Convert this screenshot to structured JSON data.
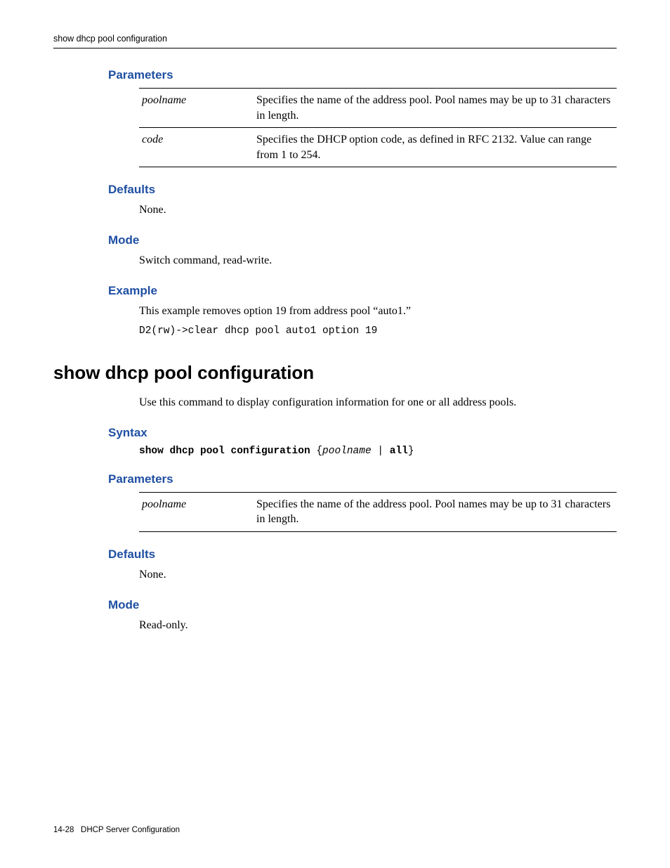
{
  "running_head": "show dhcp pool configuration",
  "sec1": {
    "parameters_heading": "Parameters",
    "table": [
      {
        "name": "poolname",
        "desc": "Specifies the name of the address pool. Pool names may be up to 31 characters in length."
      },
      {
        "name": "code",
        "desc": "Specifies the DHCP option code, as defined in RFC 2132. Value can range from 1 to 254."
      }
    ],
    "defaults_heading": "Defaults",
    "defaults_body": "None.",
    "mode_heading": "Mode",
    "mode_body": "Switch command, read-write.",
    "example_heading": "Example",
    "example_body": "This example removes option 19 from address pool “auto1.”",
    "example_code": "D2(rw)->clear dhcp pool auto1 option 19"
  },
  "cmd_title": "show dhcp pool configuration",
  "cmd_intro": "Use this command to display configuration information for one or all address pools.",
  "sec2": {
    "syntax_heading": "Syntax",
    "syntax_bold1": "show dhcp pool configuration",
    "syntax_brace_open": " {",
    "syntax_italic": "poolname",
    "syntax_sep": " | ",
    "syntax_bold2": "all",
    "syntax_brace_close": "}",
    "parameters_heading": "Parameters",
    "table": [
      {
        "name": "poolname",
        "desc": "Specifies the name of the address pool. Pool names may be up to 31 characters in length."
      }
    ],
    "defaults_heading": "Defaults",
    "defaults_body": "None.",
    "mode_heading": "Mode",
    "mode_body": "Read-only."
  },
  "footer": {
    "page": "14-28",
    "label": "DHCP Server Configuration"
  }
}
